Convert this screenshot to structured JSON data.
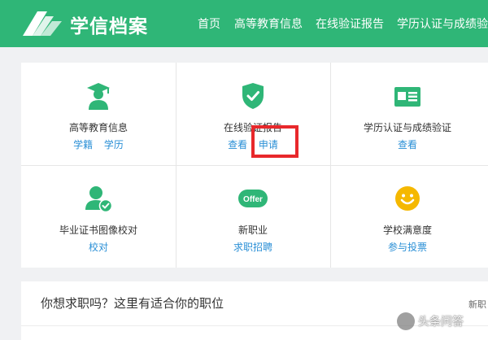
{
  "header": {
    "brand": "学信档案",
    "nav": [
      "首页",
      "高等教育信息",
      "在线验证报告",
      "学历认证与成绩验证"
    ],
    "color": "#2fb677"
  },
  "services": [
    {
      "title": "高等教育信息",
      "links": [
        "学籍",
        "学历"
      ],
      "icon": "graduate-icon"
    },
    {
      "title": "在线验证报告",
      "links": [
        "查看",
        "申请"
      ],
      "icon": "shield-check-icon"
    },
    {
      "title": "学历认证与成绩验证",
      "links": [
        "查看"
      ],
      "icon": "id-card-icon"
    },
    {
      "title": "毕业证书图像校对",
      "links": [
        "校对"
      ],
      "icon": "user-check-icon"
    },
    {
      "title": "新职业",
      "links": [
        "求职招聘"
      ],
      "icon": "offer-icon",
      "badge": "Offer"
    },
    {
      "title": "学校满意度",
      "links": [
        "参与投票"
      ],
      "icon": "smiley-icon"
    }
  ],
  "jobs": {
    "title": "你想求职吗？这里有适合你的职位",
    "more": "新职"
  },
  "watermark": "头条问答",
  "colors": {
    "accent": "#2fb677",
    "link": "#2a8fd6",
    "highlight": "#e8282b",
    "smiley": "#f5b800"
  }
}
